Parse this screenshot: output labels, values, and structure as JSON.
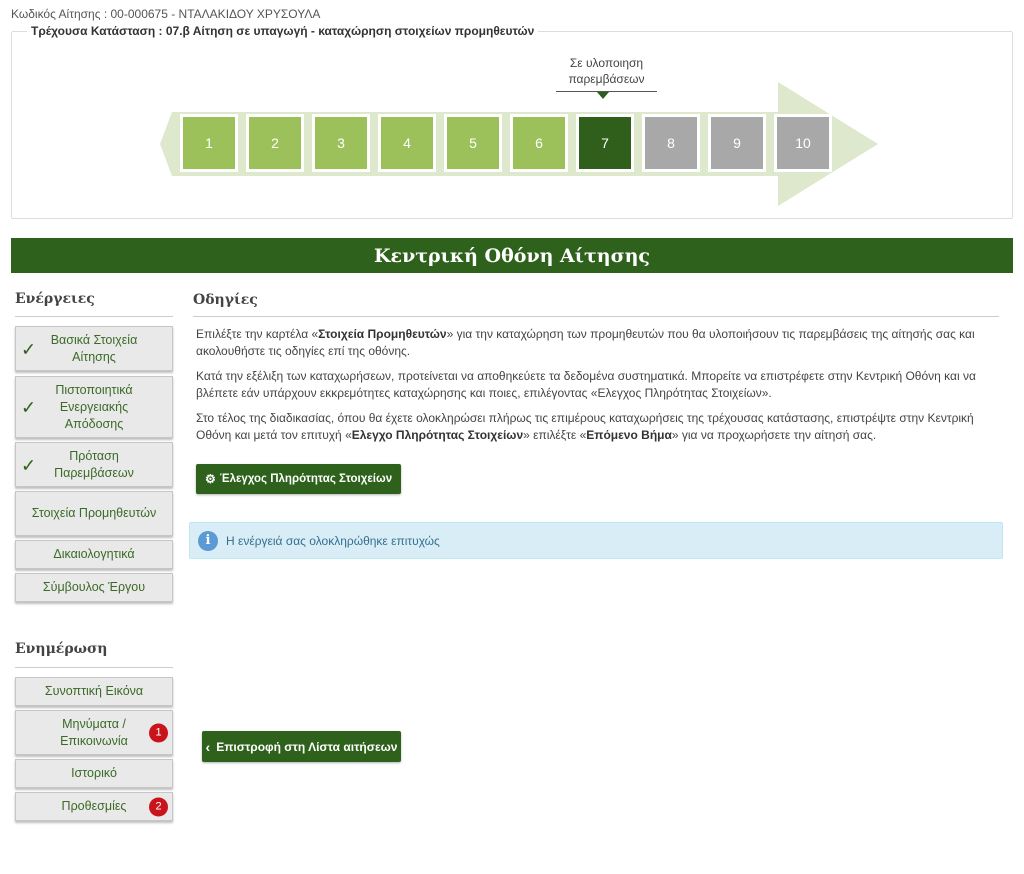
{
  "application": {
    "code_line": "Κωδικός Αίτησης : 00-000675 - ΝΤΑΛΑΚΙΔΟΥ ΧΡΥΣΟΥΛΑ",
    "current_status": "Τρέχουσα Κατάσταση : 07.β Αίτηση σε υπαγωγή - καταχώρηση στοιχείων προμηθευτών"
  },
  "progress": {
    "current_label_line1": "Σε υλοποιηση",
    "current_label_line2": "παρεμβάσεων",
    "current_step": 7,
    "steps": [
      {
        "label": "1",
        "state": "done"
      },
      {
        "label": "2",
        "state": "done"
      },
      {
        "label": "3",
        "state": "done"
      },
      {
        "label": "4",
        "state": "done"
      },
      {
        "label": "5",
        "state": "done"
      },
      {
        "label": "6",
        "state": "done"
      },
      {
        "label": "7",
        "state": "current"
      },
      {
        "label": "8",
        "state": "todo"
      },
      {
        "label": "9",
        "state": "todo"
      },
      {
        "label": "10",
        "state": "todo"
      }
    ]
  },
  "header": {
    "title": "Κεντρική Οθόνη Αίτησης"
  },
  "sidebar": {
    "actions_heading": "Ενέργειες",
    "actions": [
      {
        "label": "Βασικά Στοιχεία Αίτησης",
        "checked": true
      },
      {
        "label": "Πιστοποιητικά Ενεργειακής Απόδοσης",
        "checked": true
      },
      {
        "label": "Πρόταση Παρεμβάσεων",
        "checked": true
      },
      {
        "label": "Στοιχεία Προμηθευτών",
        "checked": false
      },
      {
        "label": "Δικαιολογητικά",
        "checked": false
      },
      {
        "label": "Σύμβουλος Έργου",
        "checked": false
      }
    ],
    "info_heading": "Ενημέρωση",
    "info": [
      {
        "label": "Συνοπτική Εικόνα",
        "badge": ""
      },
      {
        "label": "Μηνύματα / Επικοινωνία",
        "badge": "1"
      },
      {
        "label": "Ιστορικό",
        "badge": ""
      },
      {
        "label": "Προθεσμίες",
        "badge": "2"
      }
    ]
  },
  "content": {
    "title": "Οδηγίες",
    "p1": {
      "a": "Επιλέξτε την καρτέλα «",
      "b": "Στοιχεία Προμηθευτών",
      "c": "» για την καταχώρηση των προμηθευτών που θα υλοποιήσουν τις παρεμβάσεις της αίτησής σας και ακολουθήστε τις οδηγίες επί της οθόνης."
    },
    "p2": "Κατά την εξέλιξη των καταχωρήσεων, προτείνεται να αποθηκεύετε τα δεδομένα συστηματικά. Μπορείτε να επιστρέφετε στην Κεντρική Οθόνη και να βλέπετε εάν υπάρχουν εκκρεμότητες καταχώρησης και ποιες, επιλέγοντας «Ελεγχος Πληρότητας Στοιχείων».",
    "p3": {
      "a": "Στο τέλος της διαδικασίας, όπου θα έχετε ολοκληρώσει πλήρως τις επιμέρους καταχωρήσεις της τρέχουσας κατάστασης, επιστρέψτε στην Κεντρική Οθόνη και μετά τον επιτυχή «",
      "b": "Ελεγχο Πληρότητας Στοιχείων",
      "c": "» επιλέξτε «",
      "d": "Επόμενο Βήμα",
      "e": "» για να προχωρήσετε την αίτησή σας."
    },
    "check_button": "Έλεγχος Πληρότητας Στοιχείων",
    "alert": "Η ενέργειά σας ολοκληρώθηκε επιτυχώς",
    "back_button": "Επιστροφή στη Λίστα αιτήσεων"
  },
  "colors": {
    "brand_green": "#2e621c",
    "done_green": "#9cc15b",
    "pending_gray": "#a8a8a8",
    "badge_red": "#c9141b",
    "alert_bg": "#d9edf7"
  }
}
